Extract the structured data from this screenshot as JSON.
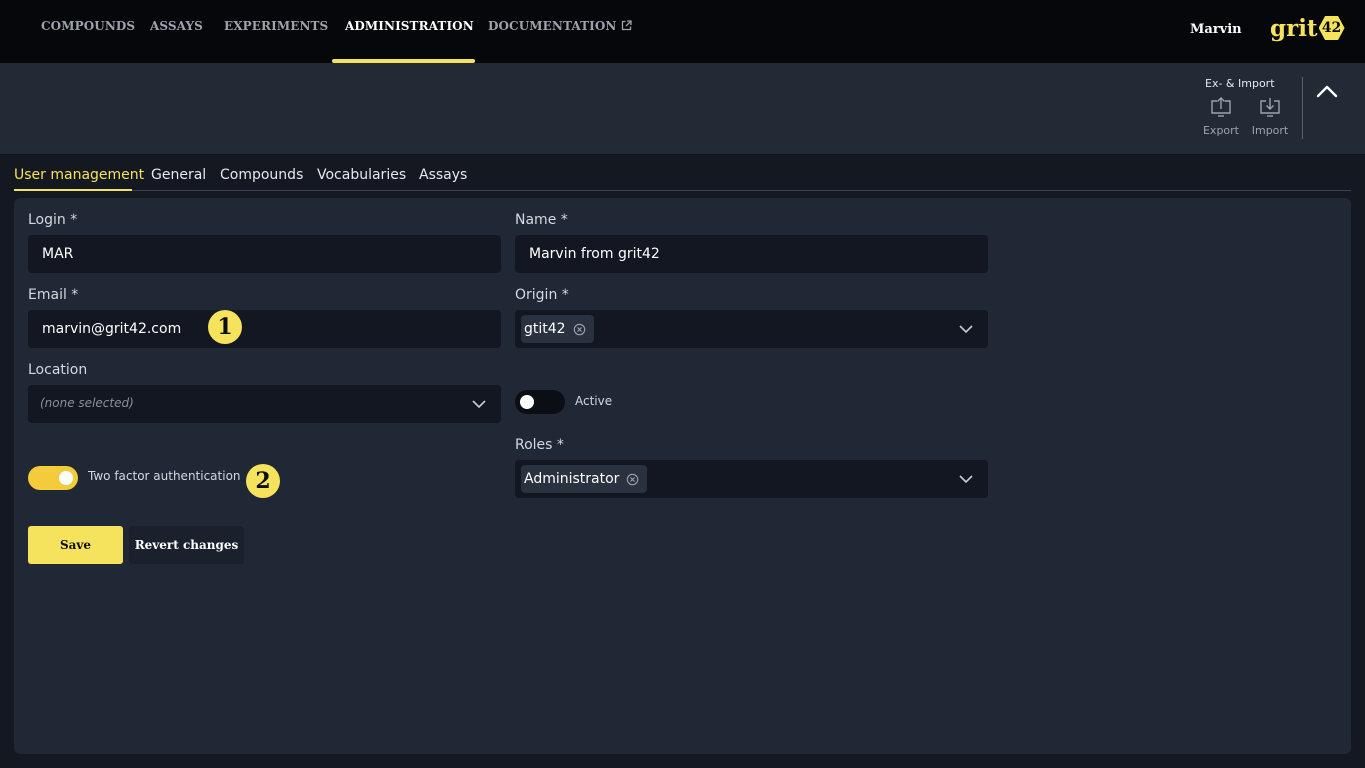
{
  "nav": {
    "items": [
      {
        "label": "COMPOUNDS"
      },
      {
        "label": "ASSAYS"
      },
      {
        "label": "EXPERIMENTS"
      },
      {
        "label": "ADMINISTRATION",
        "active": true
      },
      {
        "label": "DOCUMENTATION",
        "external": true
      }
    ],
    "user": "Marvin",
    "logo_text": "grit",
    "logo_badge": "42"
  },
  "toolbar": {
    "group_title": "Ex- & Import",
    "export_label": "Export",
    "import_label": "Import",
    "collapse_icon": "chevron-up-icon"
  },
  "tabs": [
    {
      "label": "User management",
      "active": true
    },
    {
      "label": "General"
    },
    {
      "label": "Compounds"
    },
    {
      "label": "Vocabularies"
    },
    {
      "label": "Assays"
    }
  ],
  "form": {
    "login": {
      "label": "Login *",
      "value": "MAR"
    },
    "name": {
      "label": "Name *",
      "value": "Marvin from grit42"
    },
    "email": {
      "label": "Email *",
      "value": "marvin@grit42.com"
    },
    "origin": {
      "label": "Origin *",
      "selected": "gtit42"
    },
    "location": {
      "label": "Location",
      "placeholder": "(none selected)"
    },
    "active": {
      "label": "Active",
      "on": false
    },
    "two_factor": {
      "label": "Two factor authentication",
      "on": true
    },
    "roles": {
      "label": "Roles *",
      "selected": "Administrator"
    }
  },
  "annotations": {
    "one": "1",
    "two": "2"
  },
  "actions": {
    "save": "Save",
    "revert": "Revert changes"
  },
  "colors": {
    "accent": "#f6e35d",
    "toggle_on": "#f2cc3a",
    "nav_bg": "#05070a",
    "panel_bg": "#202735",
    "input_bg": "#121721"
  }
}
